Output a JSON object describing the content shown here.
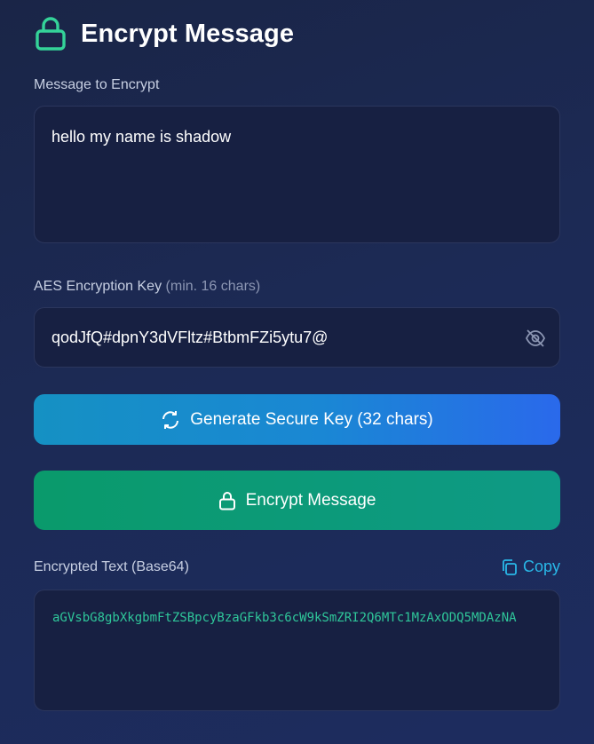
{
  "header": {
    "title": "Encrypt Message",
    "icon": "lock-icon",
    "icon_color": "#34d399"
  },
  "message": {
    "label": "Message to Encrypt",
    "value": "hello my name is shadow"
  },
  "key": {
    "label": "AES Encryption Key",
    "hint": "(min. 16 chars)",
    "value": "qodJfQ#dpnY3dVFltz#BtbmFZi5ytu7@",
    "toggle_icon": "eye-off-icon"
  },
  "generate_button": {
    "label": "Generate Secure Key (32 chars)",
    "icon": "refresh-icon"
  },
  "encrypt_button": {
    "label": "Encrypt Message",
    "icon": "lock-icon"
  },
  "output": {
    "label": "Encrypted Text (Base64)",
    "copy_label": "Copy",
    "copy_icon": "copy-icon",
    "value": "aGVsbG8gbXkgbmFtZSBpcyBzaGFkb3c6cW9kSmZRI2Q6MTc1MzAxODQ5MDAzNA"
  },
  "colors": {
    "accent_green": "#34d399",
    "accent_blue": "#29b8e8",
    "output_text": "#2fc79a"
  }
}
